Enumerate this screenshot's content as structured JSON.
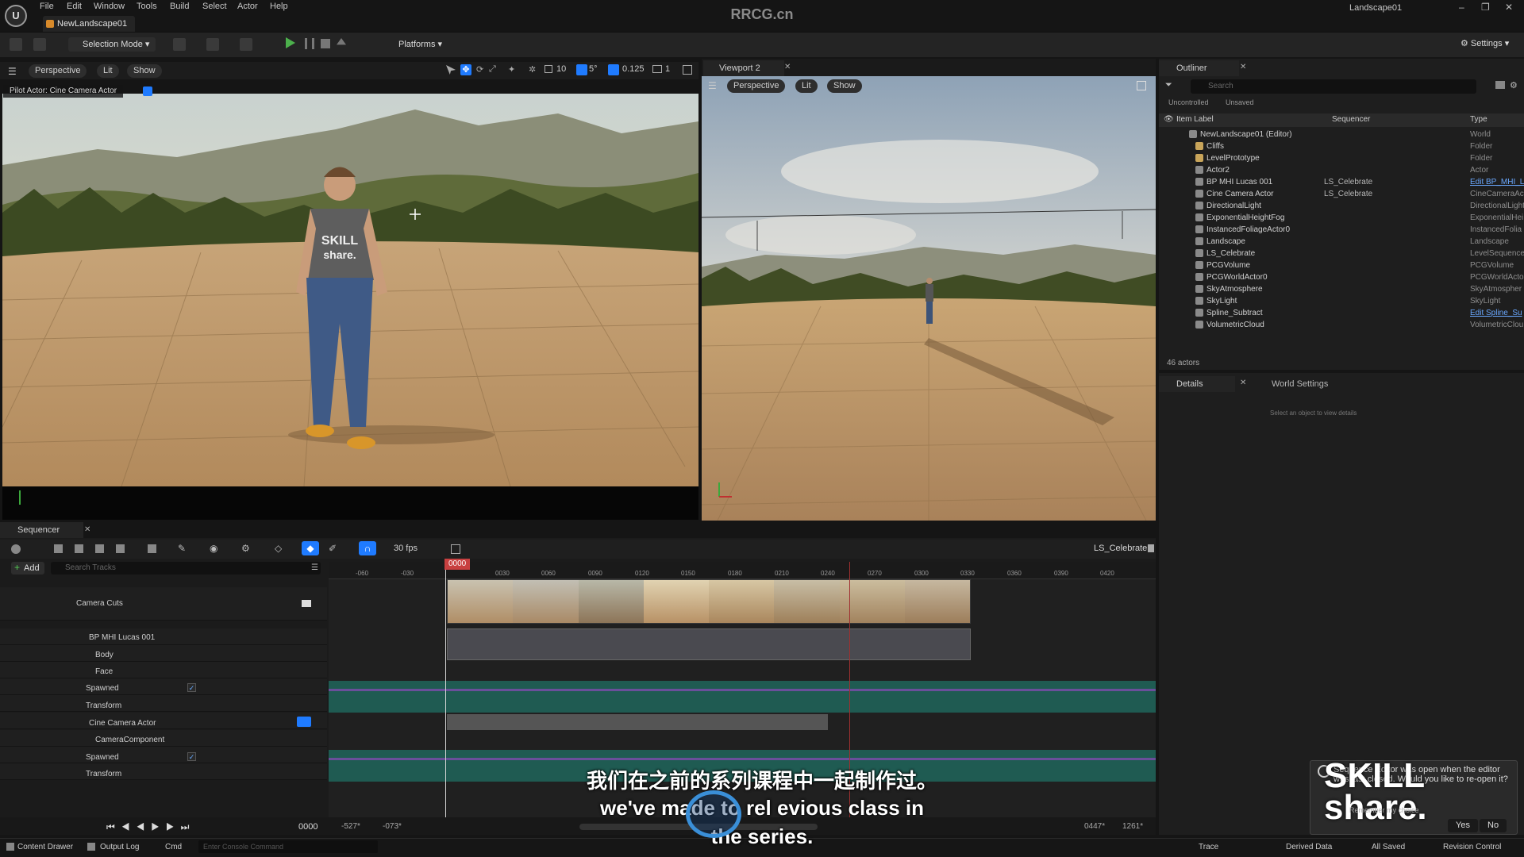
{
  "app": {
    "menu": [
      "File",
      "Edit",
      "Window",
      "Tools",
      "Build",
      "Select",
      "Actor",
      "Help"
    ],
    "level_tab": "NewLandscape01",
    "watermark": "RRCG.cn",
    "project_name": "Landscape01"
  },
  "toolbar": {
    "selection_mode": "Selection Mode",
    "platforms": "Platforms",
    "settings": "Settings"
  },
  "viewport1": {
    "perspective": "Perspective",
    "lit": "Lit",
    "show": "Show",
    "pilot_label": "Pilot Actor: Cine Camera Actor",
    "grid_snap": "10",
    "rot_snap": "5°",
    "scale_snap": "0.125",
    "camera_speed": "1",
    "shirt_text": "SKILL share."
  },
  "viewport2": {
    "tab": "Viewport 2",
    "perspective": "Perspective",
    "lit": "Lit",
    "show": "Show"
  },
  "outliner": {
    "tab": "Outliner",
    "search_placeholder": "Search",
    "filter_uncontrolled": "Uncontrolled",
    "filter_unsaved": "Unsaved",
    "col_label": "Item Label",
    "col_sequencer": "Sequencer",
    "col_type": "Type",
    "rows": [
      {
        "name": "NewLandscape01 (Editor)",
        "seq": "",
        "type": "World"
      },
      {
        "name": "Cliffs",
        "seq": "",
        "type": "Folder"
      },
      {
        "name": "LevelPrototype",
        "seq": "",
        "type": "Folder"
      },
      {
        "name": "Actor2",
        "seq": "",
        "type": "Actor"
      },
      {
        "name": "BP MHI Lucas 001",
        "seq": "LS_Celebrate",
        "type": "Edit BP_MHI_L"
      },
      {
        "name": "Cine Camera Actor",
        "seq": "LS_Celebrate",
        "type": "CineCameraAc"
      },
      {
        "name": "DirectionalLight",
        "seq": "",
        "type": "DirectionalLight"
      },
      {
        "name": "ExponentialHeightFog",
        "seq": "",
        "type": "ExponentialHei"
      },
      {
        "name": "InstancedFoliageActor0",
        "seq": "",
        "type": "InstancedFolia"
      },
      {
        "name": "Landscape",
        "seq": "",
        "type": "Landscape"
      },
      {
        "name": "LS_Celebrate",
        "seq": "",
        "type": "LevelSequence"
      },
      {
        "name": "PCGVolume",
        "seq": "",
        "type": "PCGVolume"
      },
      {
        "name": "PCGWorldActor0",
        "seq": "",
        "type": "PCGWorldActo"
      },
      {
        "name": "SkyAtmosphere",
        "seq": "",
        "type": "SkyAtmospher"
      },
      {
        "name": "SkyLight",
        "seq": "",
        "type": "SkyLight"
      },
      {
        "name": "Spline_Subtract",
        "seq": "",
        "type": "Edit Spline_Su"
      },
      {
        "name": "VolumetricCloud",
        "seq": "",
        "type": "VolumetricClou"
      }
    ],
    "actor_count": "46 actors"
  },
  "details": {
    "tab": "Details",
    "world_settings": "World Settings",
    "empty_message": "Select an object to view details"
  },
  "sequencer": {
    "tab": "Sequencer",
    "fps": "30 fps",
    "sequence_name": "LS_Celebrate",
    "add_label": "Add",
    "search_placeholder": "Search Tracks",
    "current_frame": "0000",
    "ticks": [
      "-060",
      "-030",
      "0030",
      "0060",
      "0090",
      "0120",
      "0150",
      "0180",
      "0210",
      "0240",
      "0270",
      "0300",
      "0330",
      "0360",
      "0390",
      "0420"
    ],
    "tracks": [
      {
        "label": "Camera Cuts",
        "indent": 0
      },
      {
        "label": "BP MHI Lucas 001",
        "indent": 0
      },
      {
        "label": "Body",
        "indent": 1
      },
      {
        "label": "Face",
        "indent": 1
      },
      {
        "label": "Spawned",
        "indent": 1
      },
      {
        "label": "Transform",
        "indent": 1
      },
      {
        "label": "Cine Camera Actor",
        "indent": 0
      },
      {
        "label": "CameraComponent",
        "indent": 1
      },
      {
        "label": "Spawned",
        "indent": 1
      },
      {
        "label": "Transform",
        "indent": 1
      }
    ],
    "footer_frame": "0000",
    "range_start": "-527*",
    "range_view_start": "-073*",
    "range_view_end": "0447*",
    "range_end": "1261*"
  },
  "statusbar": {
    "content_drawer": "Content Drawer",
    "output_log": "Output Log",
    "cmd": "Cmd",
    "console_placeholder": "Enter Console Command",
    "trace": "Trace",
    "derived_data": "Derived Data",
    "all_saved": "All Saved",
    "revision_control": "Revision Control"
  },
  "subtitles": {
    "chinese": "我们在之前的系列课程中一起制作过。",
    "english_line1": "we've made to",
    "english_mid": "rel",
    "english_line1b": "evious class in",
    "english_line2": "the series."
  },
  "notification": {
    "text": "Sequence Editor was open when the editor was last closed. Would you like to re-open it?",
    "checkbox_label": "Remember my choice",
    "yes": "Yes",
    "no": "No",
    "logo": "SKILL share."
  },
  "colors": {
    "accent_blue": "#1f7bff",
    "play_green": "#4cb04c",
    "playhead_red": "#c84040",
    "track_teal": "#2a6e62"
  }
}
